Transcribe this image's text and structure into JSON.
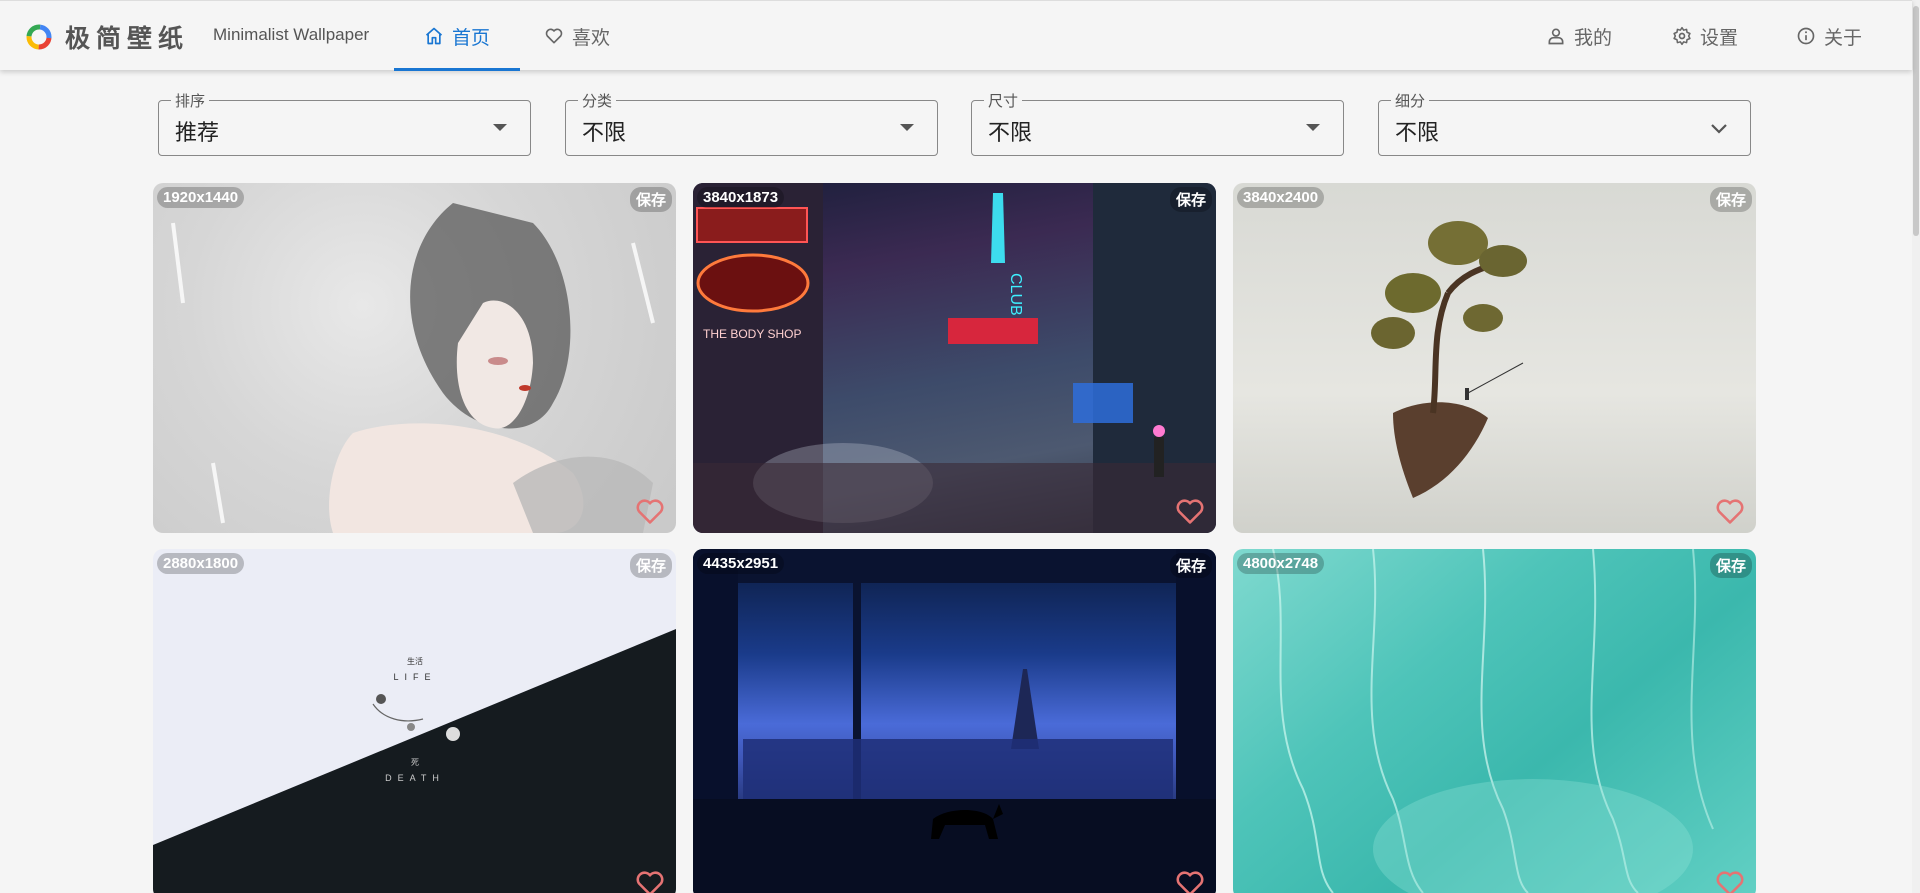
{
  "app": {
    "brand": "极简壁纸",
    "brand_sub": "Minimalist Wallpaper"
  },
  "nav": {
    "home": "首页",
    "like": "喜欢",
    "mine": "我的",
    "settings": "设置",
    "about": "关于"
  },
  "filters": [
    {
      "label": "排序",
      "value": "推荐"
    },
    {
      "label": "分类",
      "value": "不限"
    },
    {
      "label": "尺寸",
      "value": "不限"
    },
    {
      "label": "细分",
      "value": "不限"
    }
  ],
  "cards": [
    {
      "resolution": "1920x1440",
      "save": "保存"
    },
    {
      "resolution": "3840x1873",
      "save": "保存"
    },
    {
      "resolution": "3840x2400",
      "save": "保存"
    },
    {
      "resolution": "2880x1800",
      "save": "保存"
    },
    {
      "resolution": "4435x2951",
      "save": "保存"
    },
    {
      "resolution": "4800x2748",
      "save": "保存"
    }
  ],
  "art_text": {
    "life_cn": "生活",
    "life_en": "LIFE",
    "death_cn": "死",
    "death_en": "DEATH",
    "club": "CLUB",
    "shop": "THE BODY SHOP"
  },
  "colors": {
    "accent": "#1976d2",
    "heart": "#e57373"
  }
}
